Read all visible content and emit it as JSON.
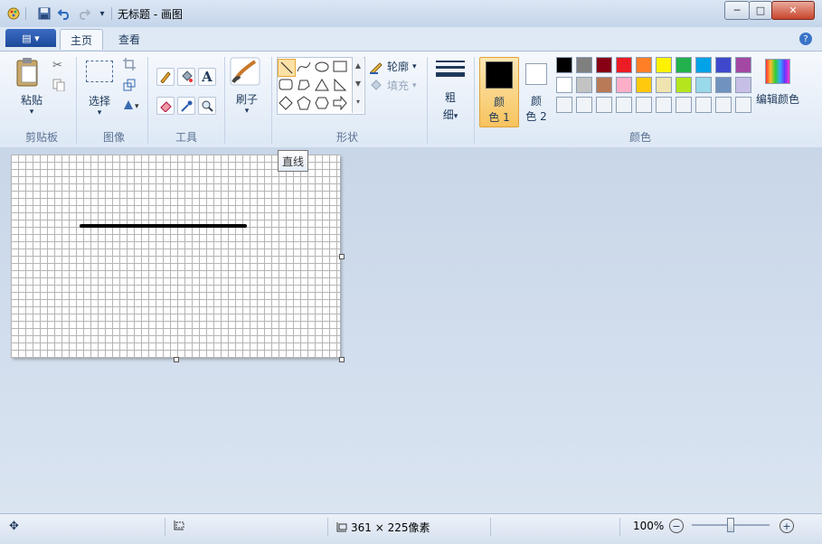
{
  "window": {
    "title": "无标题 - 画图",
    "minimize": "─",
    "maximize": "□",
    "close": "✕"
  },
  "tabs": {
    "file": "▤ ▾",
    "home": "主页",
    "view": "查看",
    "help": "?"
  },
  "ribbon": {
    "clipboard": {
      "paste": "粘贴",
      "label": "剪贴板"
    },
    "image": {
      "select": "选择",
      "label": "图像"
    },
    "tools": {
      "label": "工具",
      "text_glyph": "A"
    },
    "brushes": {
      "label": "刷子"
    },
    "shapes": {
      "outline": "轮廓",
      "fill": "填充",
      "label": "形状"
    },
    "size": {
      "line1": "粗",
      "line2": "细"
    },
    "color1": {
      "line1": "颜",
      "line2": "色 1",
      "value": "#000000"
    },
    "color2": {
      "line1": "颜",
      "line2": "色 2",
      "value": "#ffffff"
    },
    "colors": {
      "label": "颜色",
      "edit": "编辑颜色",
      "row1": [
        "#000000",
        "#7f7f7f",
        "#880015",
        "#ed1c24",
        "#ff7f27",
        "#fff200",
        "#22b14c",
        "#00a2e8",
        "#3f48cc",
        "#a349a4"
      ],
      "row2": [
        "#ffffff",
        "#c3c3c3",
        "#b97a57",
        "#ffaec9",
        "#ffc90e",
        "#efe4b0",
        "#b5e61d",
        "#99d9ea",
        "#7092be",
        "#c8bfe7"
      ],
      "row3": [
        "#f0f4f9",
        "#f0f4f9",
        "#f0f4f9",
        "#f0f4f9",
        "#f0f4f9",
        "#f0f4f9",
        "#f0f4f9",
        "#f0f4f9",
        "#f0f4f9",
        "#f0f4f9"
      ]
    }
  },
  "tooltip": "直线",
  "status": {
    "canvas_size": "361 × 225像素",
    "zoom": "100%",
    "zoom_level": 0.5
  }
}
